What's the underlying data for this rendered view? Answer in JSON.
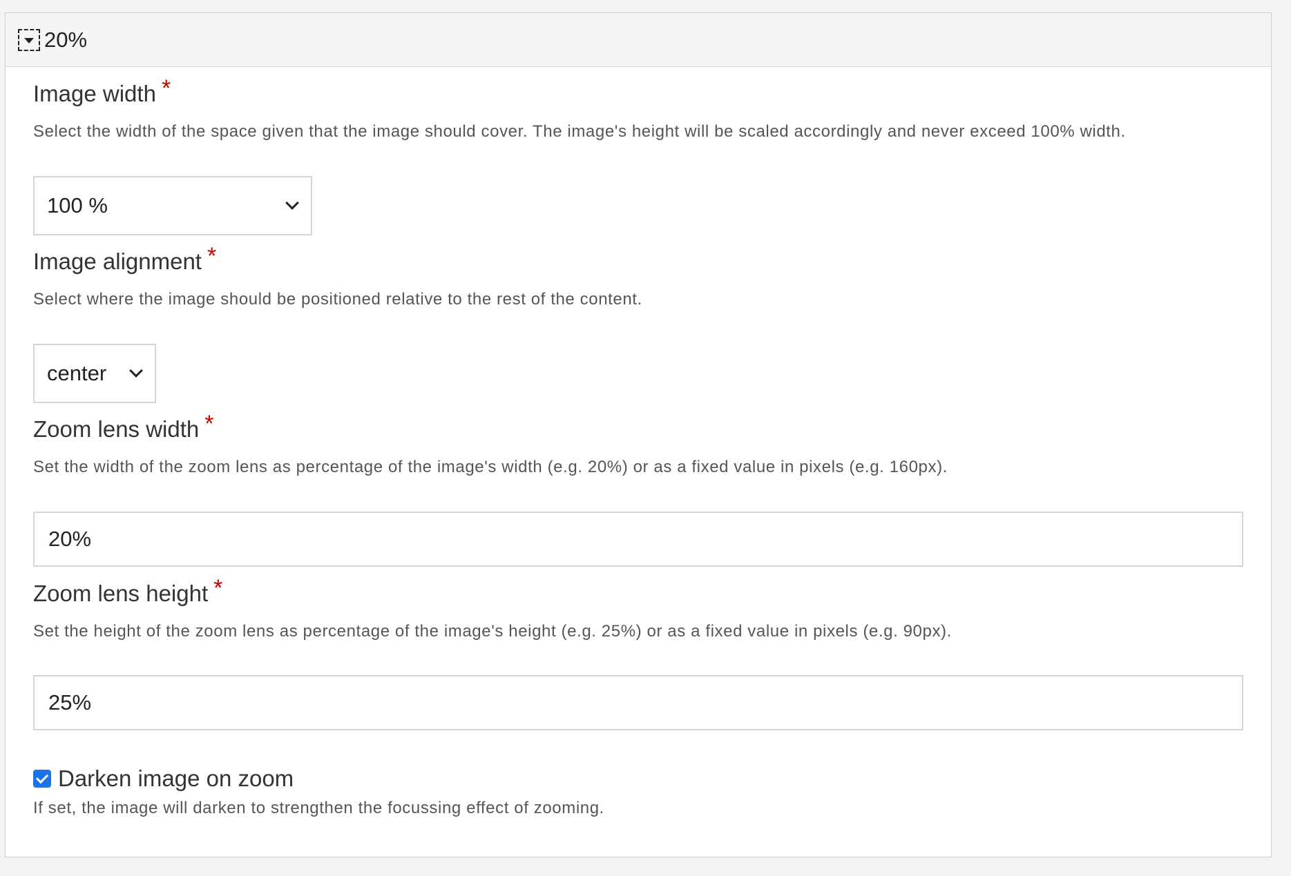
{
  "header": {
    "title": "20%"
  },
  "fields": {
    "image_width": {
      "label": "Image width",
      "required_mark": "*",
      "description": "Select the width of the space given that the image should cover. The image's height will be scaled accordingly and never exceed 100% width.",
      "value": "100 %"
    },
    "image_alignment": {
      "label": "Image alignment",
      "required_mark": "*",
      "description": "Select where the image should be positioned relative to the rest of the content.",
      "value": "center"
    },
    "zoom_lens_width": {
      "label": "Zoom lens width",
      "required_mark": "*",
      "description": "Set the width of the zoom lens as percentage of the image's width (e.g. 20%) or as a fixed value in pixels (e.g. 160px).",
      "value": "20%"
    },
    "zoom_lens_height": {
      "label": "Zoom lens height",
      "required_mark": "*",
      "description": "Set the height of the zoom lens as percentage of the image's height (e.g. 25%) or as a fixed value in pixels (e.g. 90px).",
      "value": "25%"
    },
    "darken_image": {
      "label": "Darken image on zoom",
      "description": "If set, the image will darken to strengthen the focussing effect of zooming.",
      "checked": true
    }
  },
  "colors": {
    "required": "#cc0000",
    "checkbox": "#1a73e8",
    "header_bg": "#f5f5f5"
  },
  "icons": {
    "toggle": "caret-down-icon",
    "select_arrow": "chevron-down-icon",
    "checkbox": "check-icon"
  }
}
